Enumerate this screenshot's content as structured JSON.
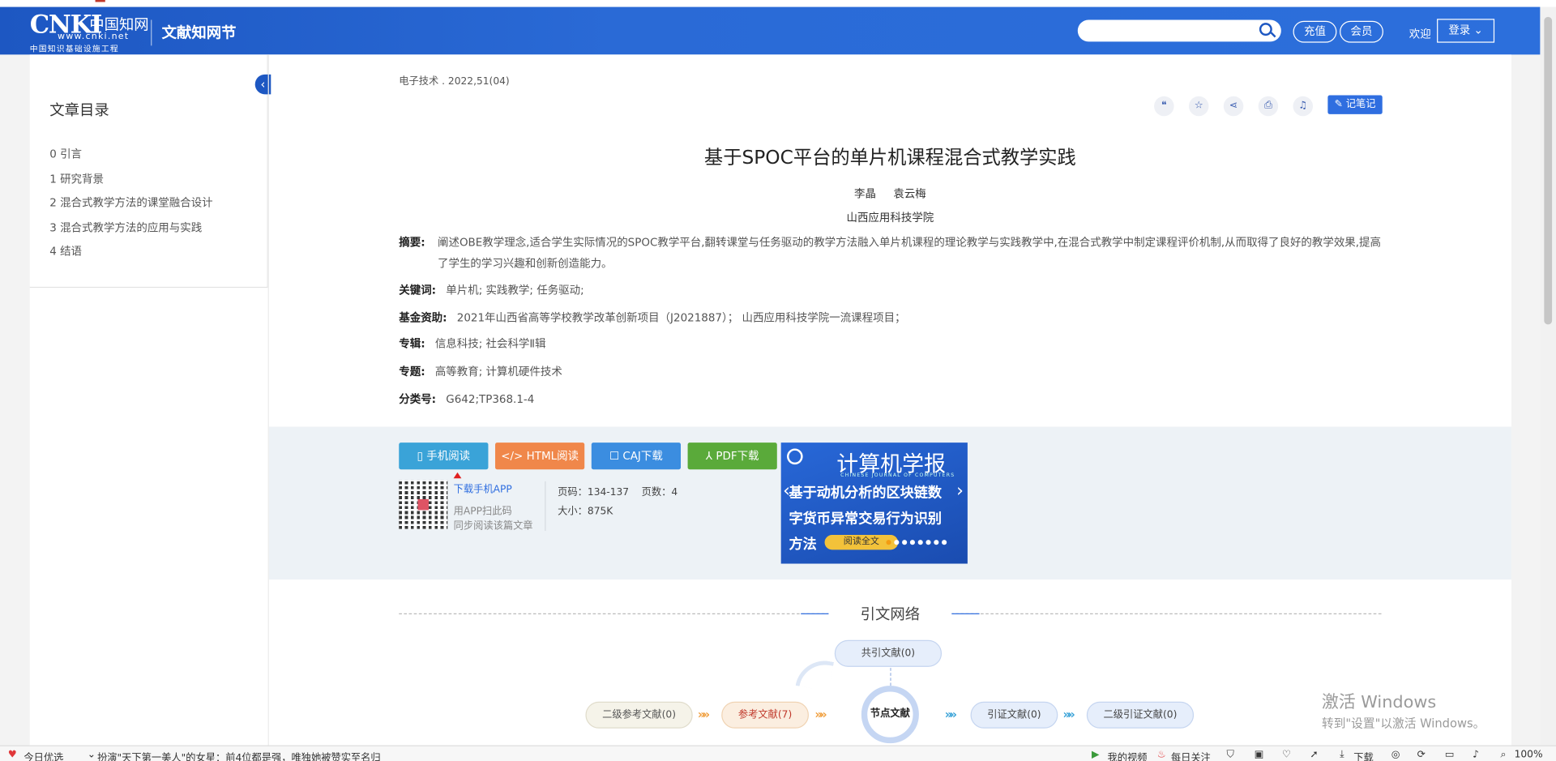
{
  "header": {
    "logo_text": "CNKI",
    "logo_cn": "中国知网",
    "logo_url": "www.cnki.net",
    "logo_sub": "中国知识基础设施工程",
    "brand": "文献知网节",
    "search_placeholder": "",
    "recharge": "充值",
    "member": "会员",
    "welcome": "欢迎",
    "login": "登录"
  },
  "sidebar": {
    "title": "文章目录",
    "items": [
      "0 引言",
      "1 研究背景",
      "2 混合式教学方法的课堂融合设计",
      "3 混合式教学方法的应用与实践",
      "4 结语"
    ]
  },
  "article": {
    "source": "电子技术 . 2022,51(04)",
    "tools": [
      "quote-icon",
      "star-icon",
      "share-icon",
      "print-icon",
      "bell-icon"
    ],
    "note_btn": "记笔记",
    "title": "基于SPOC平台的单片机课程混合式教学实践",
    "authors": "李晶 袁云梅",
    "org": "山西应用科技学院",
    "abstract_label": "摘要:",
    "abstract": "阐述OBE教学理念,适合学生实际情况的SPOC教学平台,翻转课堂与任务驱动的教学方法融入单片机课程的理论教学与实践教学中,在混合式教学中制定课程评价机制,从而取得了良好的教学效果,提高了学生的学习兴趣和创新创造能力。",
    "keywords_label": "关键词:",
    "keywords": "单片机; 实践教学; 任务驱动;",
    "fund_label": "基金资助:",
    "fund": "2021年山西省高等学校教学改革创新项目（J2021887）； 山西应用科技学院一流课程项目；",
    "series_label": "专辑:",
    "series": "信息科技; 社会科学Ⅱ辑",
    "topic_label": "专题:",
    "topic": "高等教育; 计算机硬件技术",
    "class_label": "分类号:",
    "class": "G642;TP368.1-4"
  },
  "download": {
    "mobile": "手机阅读",
    "html": "HTML阅读",
    "caj": "CAJ下载",
    "pdf": "PDF下载",
    "app": "下载手机APP",
    "scan1": "用APP扫此码",
    "scan2": "同步阅读该篇文章",
    "pages": "页码：134-137",
    "page_count": "页数：4",
    "size": "大小：875K",
    "colors": {
      "mobile": "#3aa3d8",
      "html": "#f0874a",
      "caj": "#3b8de0",
      "pdf": "#5aaa3a"
    }
  },
  "ad": {
    "journal": "计算机学报",
    "journal_en": "CHINESE JOURNAL OF COMPUTERS",
    "line1": "基于动机分析的区块链数",
    "line2": "字货币异常交易行为识别",
    "line3": "方法",
    "read": "阅读全文"
  },
  "citation": {
    "title": "引文网络",
    "co_cite": "共引文献(0)",
    "sec_ref": "二级参考文献(0)",
    "ref": "参考文献(7)",
    "node": "节点文献",
    "cited": "引证文献(0)",
    "sec_cited": "二级引证文献(0)"
  },
  "watermark": {
    "line1": "激活 Windows",
    "line2": "转到\"设置\"以激活 Windows。"
  },
  "statusbar": {
    "today": "今日优选",
    "news": "扮演\"天下第一美人\"的女星：前4位都是强，唯独她被赞实至名归",
    "video": "我的视频",
    "daily": "每日关注",
    "download": "下载",
    "zoom": "100%"
  }
}
